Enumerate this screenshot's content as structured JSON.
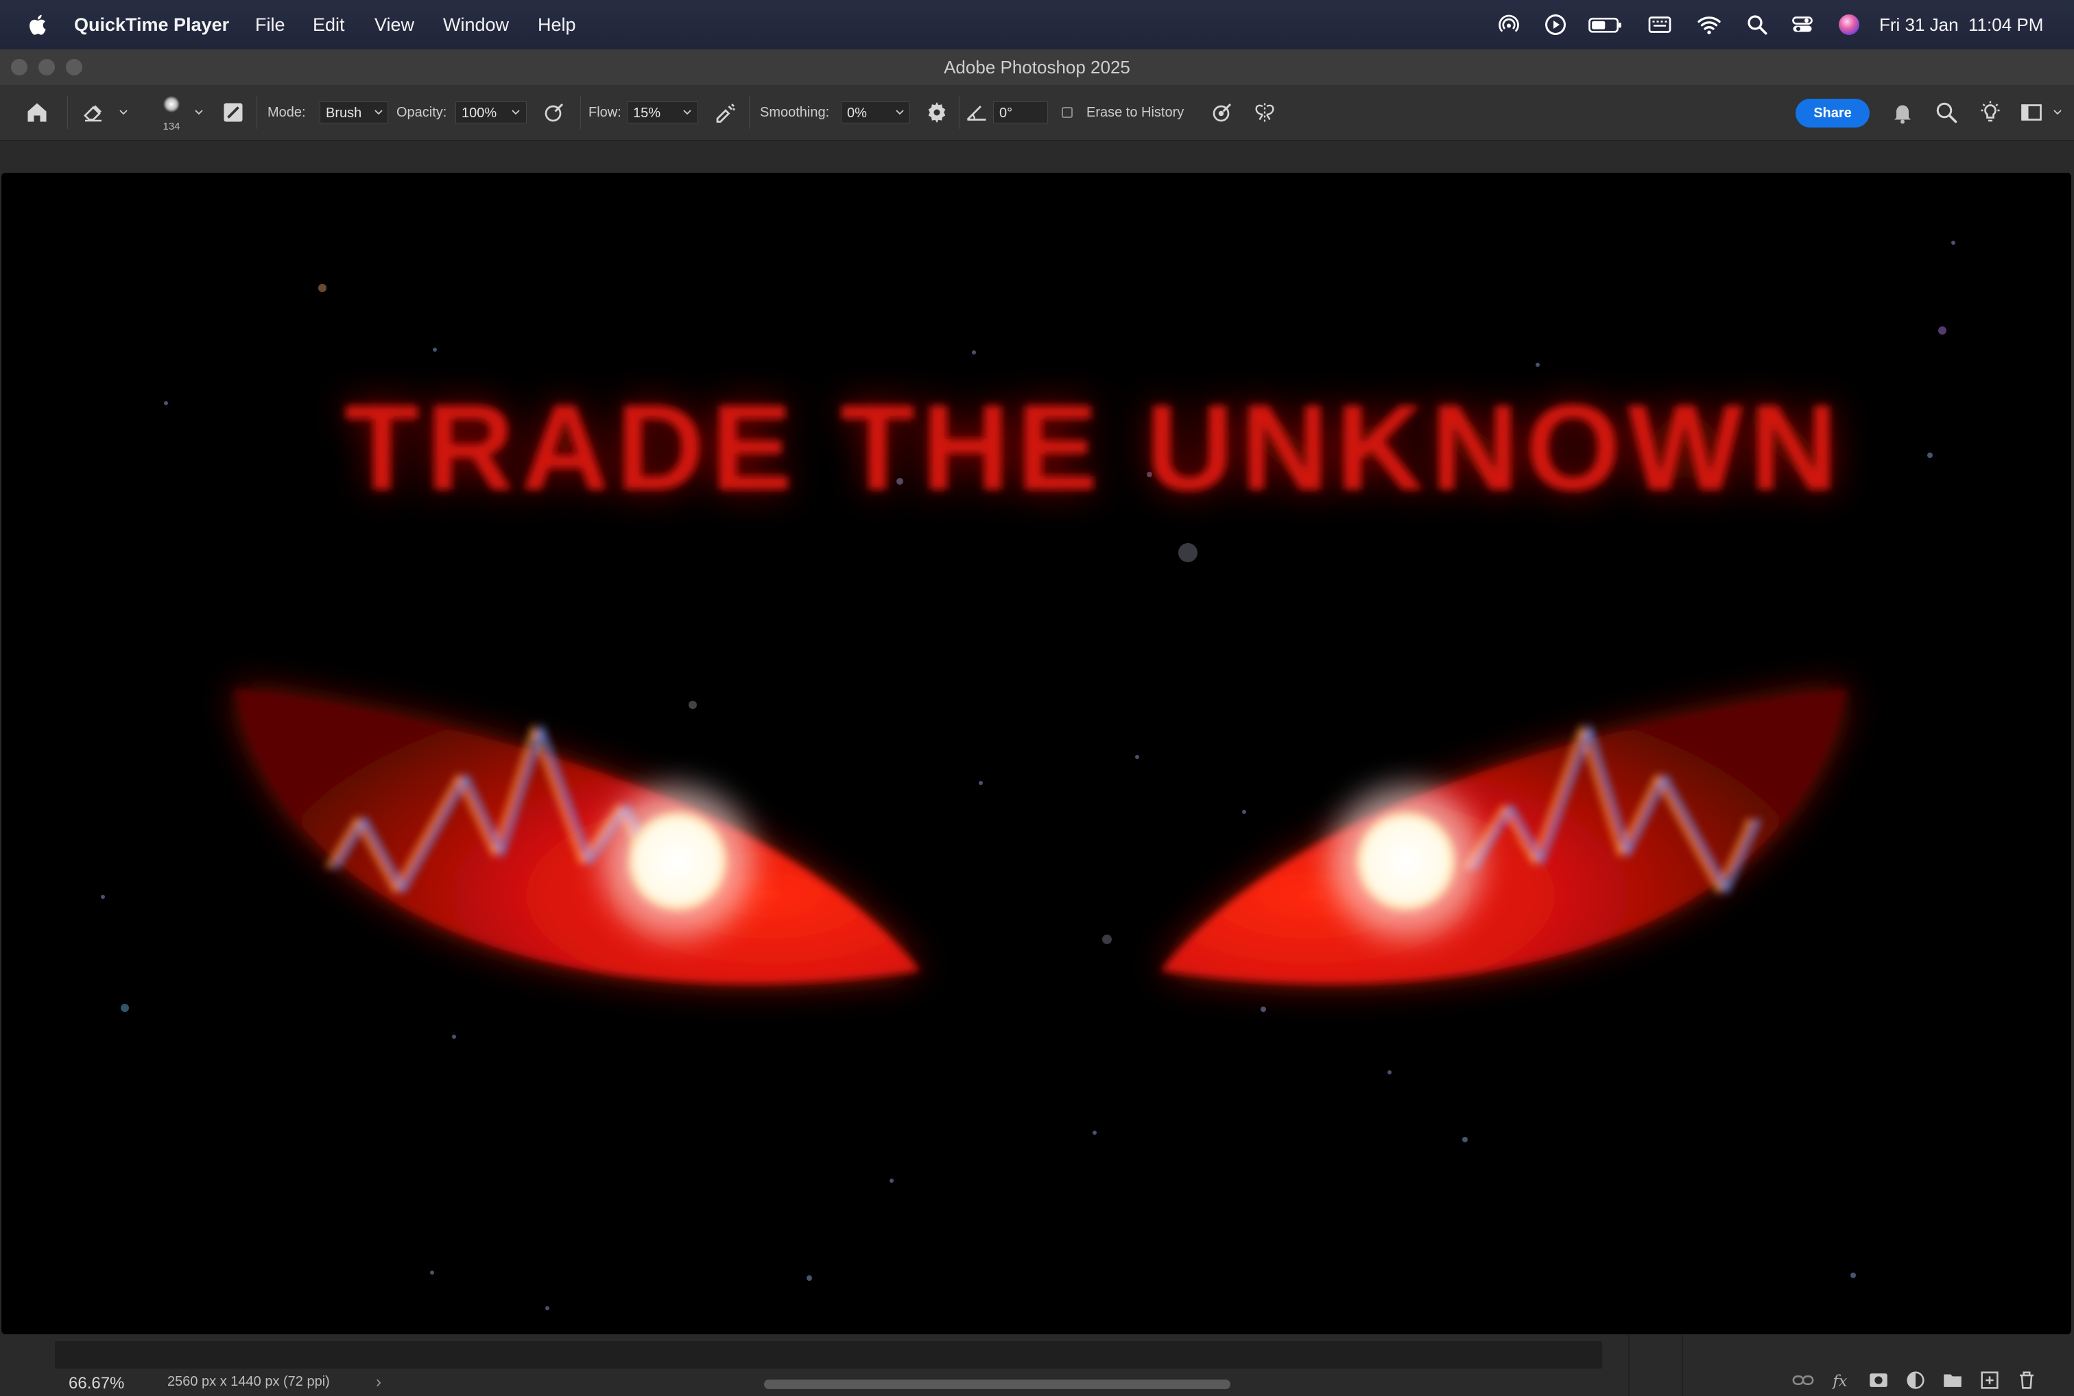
{
  "menubar": {
    "app_name": "QuickTime Player",
    "menus": [
      "File",
      "Edit",
      "View",
      "Window",
      "Help"
    ],
    "clock": "Fri 31 Jan  11:04 PM"
  },
  "window": {
    "title": "Adobe Photoshop 2025"
  },
  "options": {
    "brush_size": "134",
    "mode_label": "Mode:",
    "mode_value": "Brush",
    "opacity_label": "Opacity:",
    "opacity_value": "100%",
    "flow_label": "Flow:",
    "flow_value": "15%",
    "smoothing_label": "Smoothing:",
    "smoothing_value": "0%",
    "angle_value": "0°",
    "erase_history_label": "Erase to History",
    "share_label": "Share"
  },
  "canvas": {
    "headline": "TRADE THE UNKNOWN"
  },
  "status": {
    "zoom": "66.67%",
    "doc_size": "2560 px x 1440 px (72 ppi)",
    "arrow": "›"
  },
  "colors": {
    "accent": "#1473e6",
    "headline_red": "#d01208",
    "eye_red": "#ff1a0a"
  },
  "icons": {
    "menubar": [
      "apple-logo-icon",
      "airdrop-icon",
      "play-icon",
      "battery-icon",
      "keyboard-icon",
      "wifi-icon",
      "spotlight-icon",
      "control-center-icon",
      "siri-icon"
    ],
    "toolbar": [
      "home-icon",
      "eraser-icon",
      "brush-preset-icon",
      "airbrush-icon",
      "pressure-icon",
      "settings-gear-icon",
      "angle-icon",
      "pressure-size-icon",
      "symmetry-icon",
      "bell-icon",
      "search-icon",
      "lightbulb-icon",
      "workspace-icon"
    ],
    "layers": [
      "link-icon",
      "fx-icon",
      "mask-icon",
      "adjustment-icon",
      "folder-icon",
      "new-layer-icon",
      "trash-icon"
    ]
  }
}
